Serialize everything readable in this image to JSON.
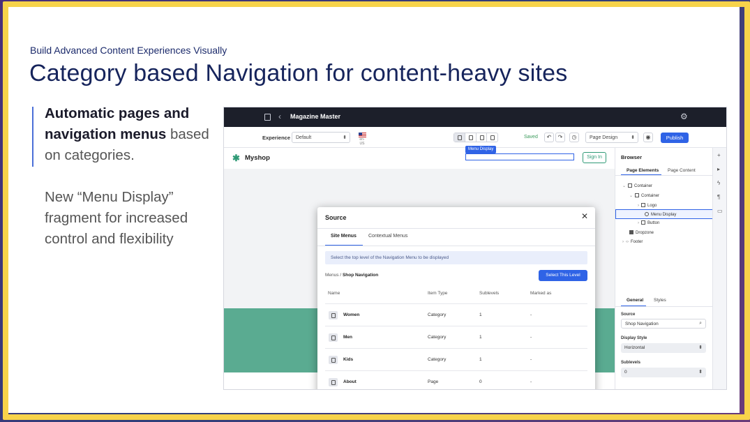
{
  "slide": {
    "kicker": "Build  Advanced Content Experiences Visually",
    "title": "Category based Navigation for content-heavy sites",
    "bullet1_bold": "Automatic pages and navigation menus",
    "bullet1_rest": " based on categories.",
    "bullet2": "New “Menu Display” fragment for increased control and flexibility"
  },
  "app": {
    "site_name": "Magazine Master",
    "toolbar": {
      "experience_label": "Experience",
      "experience_value": "Default",
      "locale": "en-US",
      "saved": "Saved",
      "mode": "Page Design",
      "publish": "Publish"
    },
    "canvas": {
      "logo_text": "Myshop",
      "menu_tag": "Menu Display",
      "sign_in": "Sign In"
    },
    "modal": {
      "title": "Source",
      "tabs": [
        "Site Menus",
        "Contextual Menus"
      ],
      "info": "Select the top level of the Navigation Menu to be displayed",
      "crumb_root": "Menus",
      "crumb_current": "Shop Navigation",
      "select_button": "Select This Level",
      "columns": [
        "Name",
        "Item Type",
        "Sublevels",
        "Marked as"
      ],
      "rows": [
        {
          "name": "Women",
          "type": "Category",
          "sublevels": "1",
          "marked": "-"
        },
        {
          "name": "Men",
          "type": "Category",
          "sublevels": "1",
          "marked": "-"
        },
        {
          "name": "Kids",
          "type": "Category",
          "sublevels": "1",
          "marked": "-"
        },
        {
          "name": "About",
          "type": "Page",
          "sublevels": "0",
          "marked": "-"
        }
      ]
    },
    "panel": {
      "title": "Browser",
      "tabs": [
        "Page Elements",
        "Page Content"
      ],
      "tree": [
        "Container",
        "Container",
        "Logo",
        "Menu Display",
        "Button",
        "Dropzone",
        "Footer"
      ],
      "config_tabs": [
        "General",
        "Styles"
      ],
      "source_label": "Source",
      "source_value": "Shop Navigation",
      "display_style_label": "Display Style",
      "display_style_value": "Horizontal",
      "sublevels_label": "Sublevels",
      "sublevels_value": "0"
    }
  },
  "colors": {
    "accent": "#2f63e6",
    "frame": "#f7d34a",
    "title": "#16245c",
    "green": "#5aab91"
  }
}
